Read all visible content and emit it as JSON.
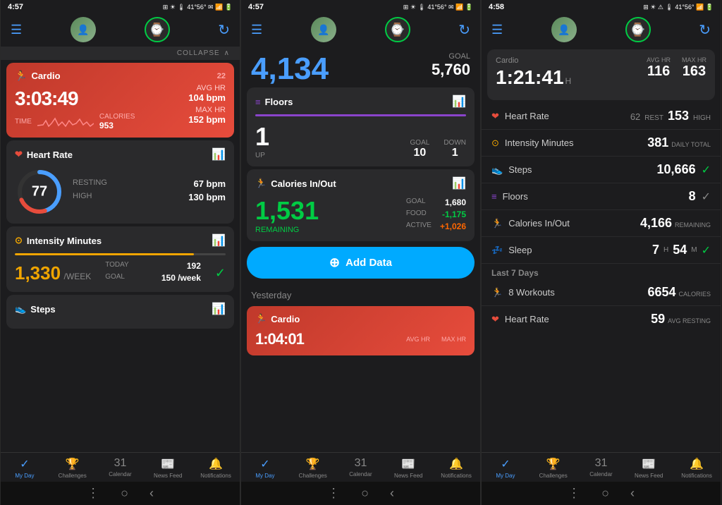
{
  "phone1": {
    "status": {
      "time": "4:57",
      "temp": "41° 56°"
    },
    "cardio": {
      "title": "Cardio",
      "time": "3:03:49",
      "avg_hr_label": "AVG HR",
      "avg_hr": "104 bpm",
      "max_hr_label": "MAX HR",
      "max_hr": "152 bpm",
      "time_label": "TIME",
      "calories_label": "CALORIES",
      "calories": "953"
    },
    "heart_rate": {
      "title": "Heart Rate",
      "current": "77",
      "resting_label": "RESTING",
      "resting": "67 bpm",
      "high_label": "HIGH",
      "high": "130 bpm"
    },
    "intensity": {
      "title": "Intensity Minutes",
      "main": "1,330",
      "unit": "/WEEK",
      "today_label": "TODAY",
      "today": "192",
      "goal_label": "GOAL",
      "goal": "150 /week"
    },
    "steps": {
      "title": "Steps"
    },
    "nav": {
      "my_day": "My Day",
      "challenges": "Challenges",
      "calendar": "Calendar",
      "news_feed": "News Feed",
      "notifications": "Notifications"
    }
  },
  "phone2": {
    "status": {
      "time": "4:57",
      "temp": "41° 56°"
    },
    "steps_today": {
      "value": "4,134",
      "goal_label": "GOAL",
      "goal": "5,760"
    },
    "floors": {
      "title": "Floors",
      "up": "1",
      "up_label": "UP",
      "goal_label": "GOAL",
      "goal": "10",
      "down_label": "DOWN",
      "down": "1"
    },
    "calories": {
      "title": "Calories In/Out",
      "main": "1,531",
      "remaining_label": "REMAINING",
      "goal_label": "GOAL",
      "goal": "1,680",
      "food_label": "FOOD",
      "food": "-1,175",
      "active_label": "ACTIVE",
      "active": "+1,026"
    },
    "add_data": "Add Data",
    "yesterday": "Yesterday",
    "yesterday_cardio": {
      "title": "Cardio",
      "time": "1:04:01",
      "avg_hr_label": "AVG HR",
      "max_hr_label": "MAX HR"
    },
    "nav": {
      "my_day": "My Day",
      "challenges": "Challenges",
      "calendar": "Calendar",
      "news_feed": "News Feed",
      "notifications": "Notifications"
    }
  },
  "phone3": {
    "status": {
      "time": "4:58",
      "temp": "41° 56°"
    },
    "cardio": {
      "title": "Cardio",
      "time": "1:21:41",
      "time_unit": "H",
      "avg_hr_label": "AVG HR",
      "avg_hr": "116",
      "max_hr_label": "MAX HR",
      "max_hr": "163"
    },
    "heart_rate": {
      "label": "Heart Rate",
      "rest": "62",
      "rest_label": "REST",
      "high": "153",
      "high_label": "HIGH"
    },
    "intensity": {
      "label": "Intensity Minutes",
      "value": "381",
      "unit": "DAILY TOTAL"
    },
    "steps": {
      "label": "Steps",
      "value": "10,666"
    },
    "floors": {
      "label": "Floors",
      "value": "8"
    },
    "calories": {
      "label": "Calories In/Out",
      "value": "4,166",
      "unit": "REMAINING"
    },
    "sleep": {
      "label": "Sleep",
      "hours": "7",
      "h_unit": "H",
      "mins": "54",
      "m_unit": "M"
    },
    "last7": {
      "label": "Last 7 Days",
      "workouts": "8 Workouts",
      "calories": "6654",
      "calories_label": "CALORIES",
      "hr_label": "Heart Rate",
      "hr_val": "59",
      "hr_unit": "AVG RESTING"
    },
    "nav": {
      "my_day": "My Day",
      "challenges": "Challenges",
      "calendar": "Calendar",
      "news_feed": "News Feed",
      "notifications": "Notifications"
    }
  }
}
